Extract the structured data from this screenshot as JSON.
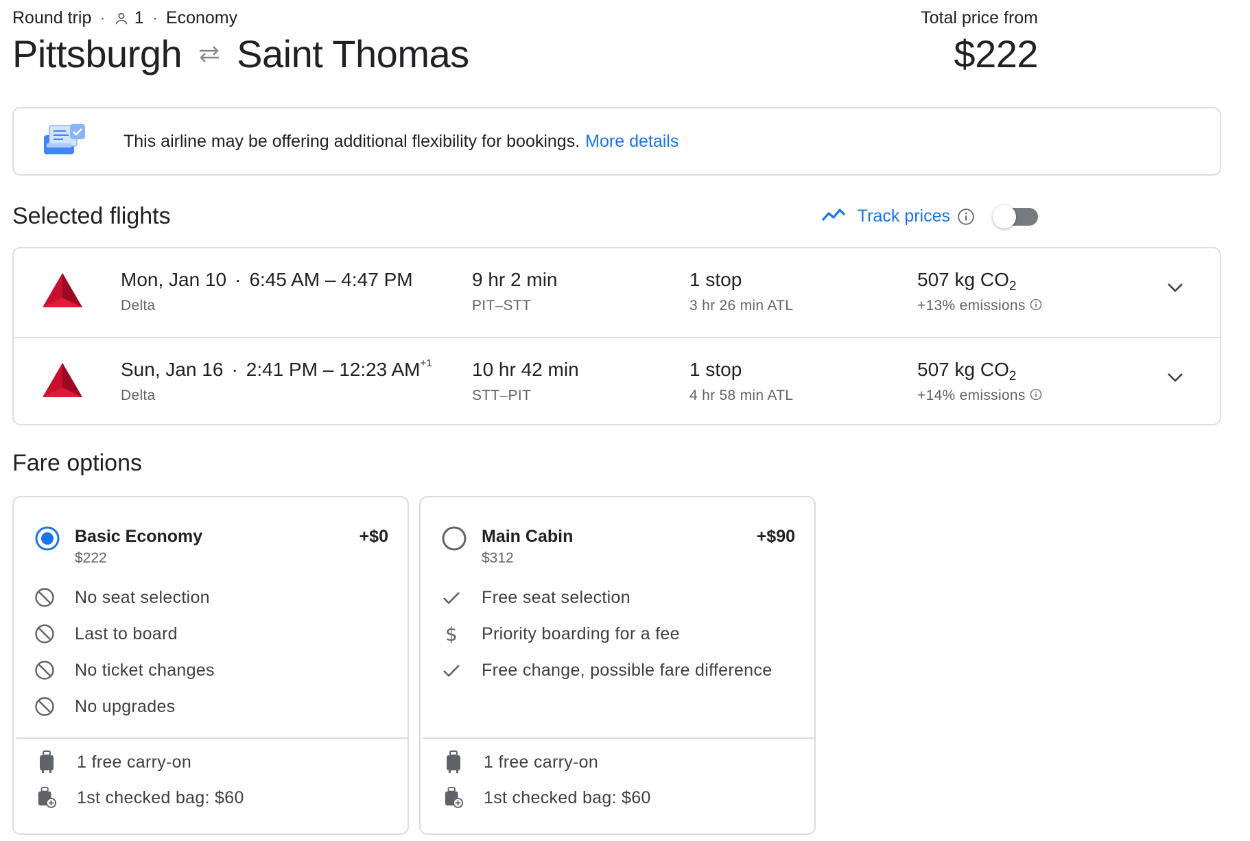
{
  "header": {
    "trip_type": "Round trip",
    "passengers": "1",
    "cabin": "Economy",
    "origin": "Pittsburgh",
    "destination": "Saint Thomas",
    "price_label": "Total price from",
    "price": "$222"
  },
  "banner": {
    "text": "This airline may be offering additional flexibility for bookings.",
    "link": "More details"
  },
  "selected_flights": {
    "title": "Selected flights",
    "track_prices_label": "Track prices",
    "track_prices_on": false,
    "flights": [
      {
        "date": "Mon, Jan 10",
        "times": "6:45 AM – 4:47 PM",
        "day_offset": "",
        "airline": "Delta",
        "duration": "9 hr 2 min",
        "route": "PIT–STT",
        "stops": "1 stop",
        "layover": "3 hr 26 min ATL",
        "co2_value": "507 kg CO",
        "co2_sub": "2",
        "emissions": "+13% emissions"
      },
      {
        "date": "Sun, Jan 16",
        "times": "2:41 PM – 12:23 AM",
        "day_offset": "+1",
        "airline": "Delta",
        "duration": "10 hr 42 min",
        "route": "STT–PIT",
        "stops": "1 stop",
        "layover": "4 hr 58 min ATL",
        "co2_value": "507 kg CO",
        "co2_sub": "2",
        "emissions": "+14% emissions"
      }
    ]
  },
  "fare_options": {
    "title": "Fare options",
    "fares": [
      {
        "name": "Basic Economy",
        "price": "$222",
        "delta": "+$0",
        "selected": true,
        "features": [
          {
            "icon": "block-icon",
            "text": "No seat selection"
          },
          {
            "icon": "block-icon",
            "text": "Last to board"
          },
          {
            "icon": "block-icon",
            "text": "No ticket changes"
          },
          {
            "icon": "block-icon",
            "text": "No upgrades"
          }
        ],
        "bags": [
          {
            "icon": "carry-on-icon",
            "text": "1 free carry-on"
          },
          {
            "icon": "checked-bag-icon",
            "text": "1st checked bag: $60"
          }
        ]
      },
      {
        "name": "Main Cabin",
        "price": "$312",
        "delta": "+$90",
        "selected": false,
        "features": [
          {
            "icon": "check-icon",
            "text": "Free seat selection"
          },
          {
            "icon": "dollar-icon",
            "text": "Priority boarding for a fee"
          },
          {
            "icon": "check-icon",
            "text": "Free change, possible fare difference"
          }
        ],
        "bags": [
          {
            "icon": "carry-on-icon",
            "text": "1 free carry-on"
          },
          {
            "icon": "checked-bag-icon",
            "text": "1st checked bag: $60"
          }
        ]
      }
    ]
  },
  "colors": {
    "accent": "#1a73e8",
    "delta_red": "#c8102e",
    "border": "#dadce0",
    "secondary_text": "#5f6368"
  }
}
